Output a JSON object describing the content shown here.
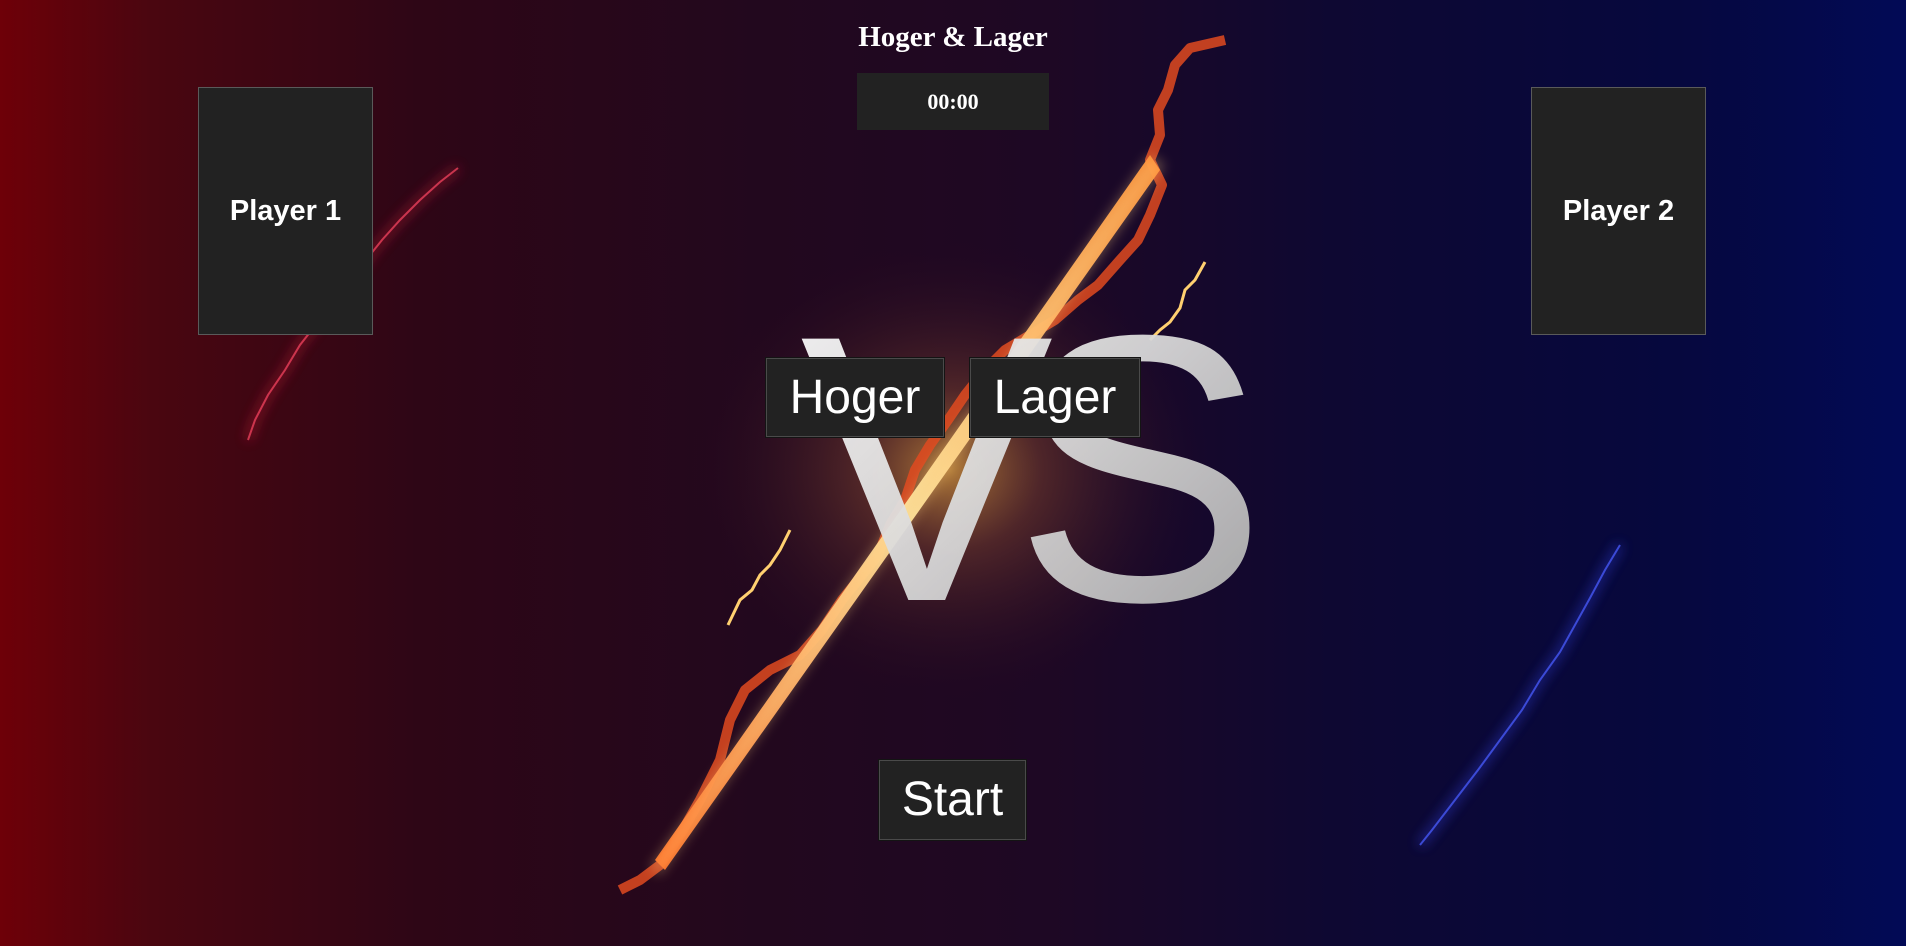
{
  "game": {
    "title": "Hoger & Lager",
    "timer": "00:00"
  },
  "players": [
    {
      "label": "Player 1"
    },
    {
      "label": "Player 2"
    }
  ],
  "controls": {
    "higher_label": "Hoger",
    "lower_label": "Lager",
    "start_label": "Start"
  },
  "background": {
    "versus_text": "VS",
    "colors": {
      "left": "#6e0008",
      "center": "#22081e",
      "right": "#020a56",
      "lightning_center": "#ffb347",
      "lightning_left": "#d0203a",
      "lightning_right": "#3040e0"
    }
  }
}
